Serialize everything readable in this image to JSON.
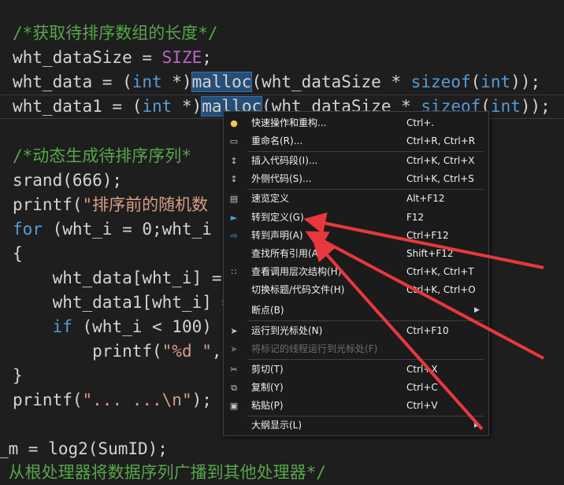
{
  "code": {
    "line1": "/*获取待排序数组的长度*/",
    "line2": {
      "ident": "wht_dataSize = ",
      "macro": "SIZE",
      "tail": ";"
    },
    "line3": {
      "a": "wht_data = (",
      "kw1": "int",
      "b": " *)",
      "sel": "malloc",
      "c": "(wht_dataSize * ",
      "kw2": "sizeof",
      "d": "(",
      "kw3": "int",
      "e": "));"
    },
    "line4": {
      "a": "wht_data1 = (",
      "kw1": "int",
      "b": " *)",
      "sel": "malloc",
      "c": "(wht_dataSize * ",
      "kw2": "sizeof",
      "d": "(",
      "kw3": "int",
      "e": "));"
    },
    "line5": "/*动态生成待排序序列*",
    "line6": "srand(666);",
    "line7": {
      "a": "printf(",
      "str": "\"排序前的随机数"
    },
    "line8": {
      "kw": "for",
      "a": " (wht_i = 0;wht_i "
    },
    "line9": "{",
    "line10": "    wht_data[wht_i] =",
    "line11": "    wht_data1[wht_i] =",
    "line12": {
      "indent": "    ",
      "kw": "if",
      "a": " (wht_i < 100)"
    },
    "line13": {
      "indent": "        printf(",
      "str": "\"%d \"",
      "tail": ","
    },
    "line14": "}",
    "line15": {
      "a": "printf(",
      "str": "\"... ...\\n\"",
      "tail": ");"
    },
    "line16": "_m = log2(SumID);",
    "line17": " 从根处理器将数据序列广播到其他处理器*/"
  },
  "context_menu": {
    "items": [
      {
        "icon": "lightbulb-icon",
        "label": "快速操作和重构...",
        "shortcut": "Ctrl+."
      },
      {
        "icon": "rename-icon",
        "label": "重命名(R)...",
        "shortcut": "Ctrl+R, Ctrl+R"
      },
      {
        "icon": "insert-snippet-icon",
        "label": "插入代码段(I)...",
        "shortcut": "Ctrl+K, Ctrl+X"
      },
      {
        "icon": "surround-with-icon",
        "label": "外侧代码(S)...",
        "shortcut": "Ctrl+K, Ctrl+S"
      },
      {
        "icon": "peek-definition-icon",
        "label": "速览定义",
        "shortcut": "Alt+F12"
      },
      {
        "icon": "go-to-definition-icon",
        "label": "转到定义(G)",
        "shortcut": "F12"
      },
      {
        "icon": "go-to-declaration-icon",
        "label": "转到声明(A)",
        "shortcut": "Ctrl+F12"
      },
      {
        "icon": "",
        "label": "查找所有引用(A)",
        "shortcut": "Shift+F12"
      },
      {
        "icon": "call-hierarchy-icon",
        "label": "查看调用层次结构(H)",
        "shortcut": "Ctrl+K, Ctrl+T"
      },
      {
        "icon": "",
        "label": "切换标题/代码文件(H)",
        "shortcut": "Ctrl+K, Ctrl+O"
      },
      {
        "icon": "",
        "label": "断点(B)",
        "shortcut": ""
      },
      {
        "icon": "run-to-cursor-icon",
        "label": "运行到光标处(N)",
        "shortcut": "Ctrl+F10"
      },
      {
        "icon": "run-flagged-threads-icon",
        "label": "将标记的线程运行到光标处(F)",
        "shortcut": ""
      },
      {
        "icon": "cut-icon",
        "label": "剪切(T)",
        "shortcut": "Ctrl+X"
      },
      {
        "icon": "copy-icon",
        "label": "复制(Y)",
        "shortcut": "Ctrl+C"
      },
      {
        "icon": "paste-icon",
        "label": "粘贴(P)",
        "shortcut": "Ctrl+V"
      },
      {
        "icon": "",
        "label": "大纲显示(L)",
        "shortcut": ""
      }
    ]
  },
  "colors": {
    "annotation_arrow": "#e8383d",
    "selection": "#264f78",
    "comment": "#57a64a",
    "keyword": "#569cd6"
  }
}
